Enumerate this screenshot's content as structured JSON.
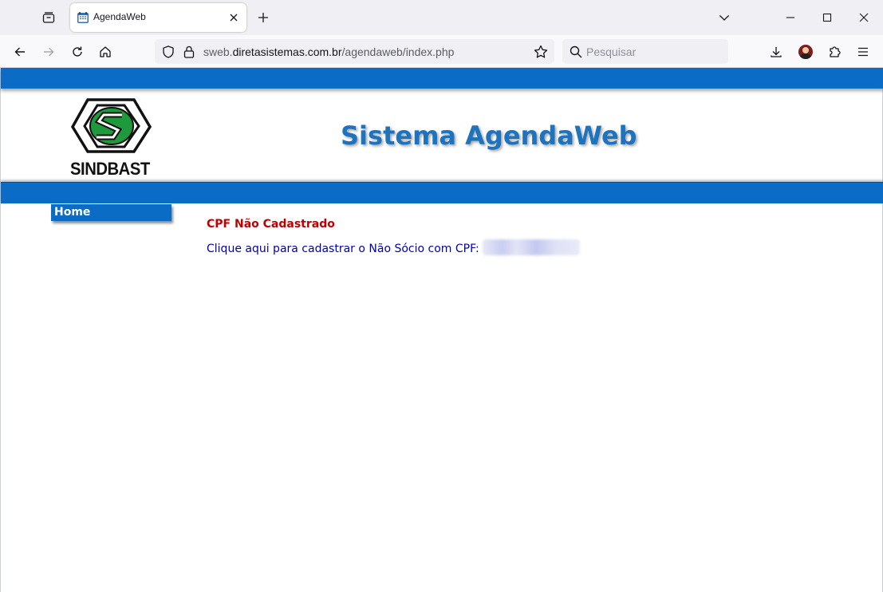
{
  "browser": {
    "tab": {
      "title": "AgendaWeb",
      "favicon": "agendaweb-favicon"
    },
    "url": {
      "prefix": "sweb.",
      "domain": "diretasistemas.com.br",
      "path": "/agendaweb/index.php"
    },
    "search": {
      "placeholder": "Pesquisar"
    },
    "icons": {
      "tab_overview": "tab-overview-icon",
      "close_tab": "close-icon",
      "new_tab": "plus-icon",
      "tab_list": "chevron-down-icon",
      "minimize": "minimize-icon",
      "maximize": "maximize-icon",
      "close_window": "close-icon",
      "back": "arrow-left-icon",
      "forward": "arrow-right-icon",
      "reload": "reload-icon",
      "home": "home-icon",
      "shield": "shield-icon",
      "lock": "lock-icon",
      "bookmark": "star-icon",
      "download": "download-icon",
      "account": "avatar",
      "extensions": "puzzle-icon",
      "menu": "hamburger-menu-icon"
    }
  },
  "page": {
    "logo_text": "SINDBAST",
    "title": "Sistema AgendaWeb",
    "menu": {
      "home": "Home"
    },
    "error_message": "CPF Não Cadastrado",
    "register_link": "Clique aqui para cadastrar o Não Sócio com CPF:",
    "colors": {
      "band": "#0a6cc4",
      "title": "#1e73be",
      "error": "#c00000",
      "link": "#0000b4",
      "logo_green": "#1e9a3c"
    }
  }
}
